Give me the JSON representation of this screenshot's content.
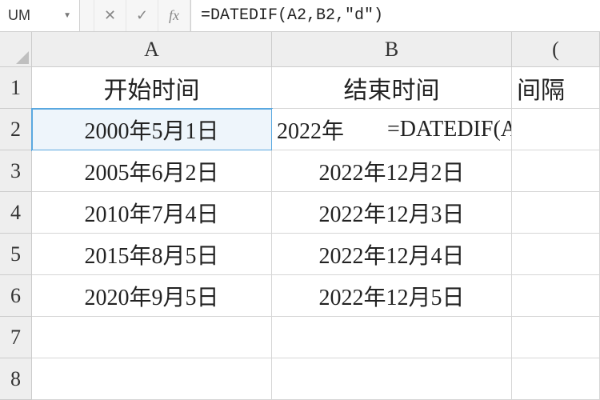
{
  "formula_bar": {
    "name_box": "UM",
    "cancel_glyph": "✕",
    "enter_glyph": "✓",
    "fx_glyph": "fx",
    "formula": "=DATEDIF(A2,B2,\"d\")"
  },
  "columns": {
    "A": "A",
    "B": "B",
    "C": "("
  },
  "rows": [
    "1",
    "2",
    "3",
    "4",
    "5",
    "6",
    "7",
    "8"
  ],
  "headers": {
    "A": "开始时间",
    "B": "结束时间",
    "C": "间隔"
  },
  "cells": {
    "A2": "2000年5月1日",
    "B2_partial": "2022年",
    "C2_spill": "=DATEDIF(A",
    "A3": "2005年6月2日",
    "B3": "2022年12月2日",
    "A4": "2010年7月4日",
    "B4": "2022年12月3日",
    "A5": "2015年8月5日",
    "B5": "2022年12月4日",
    "A6": "2020年9月5日",
    "B6": "2022年12月5日"
  }
}
